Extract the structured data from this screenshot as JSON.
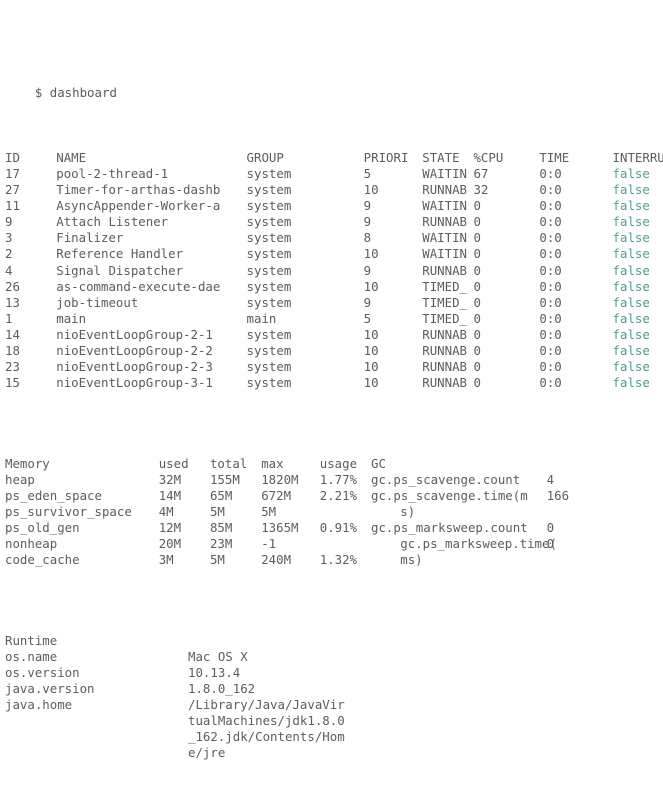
{
  "terminal": {
    "prompt": "$ dashboard",
    "prompt_symbol": "$",
    "command": "dashboard",
    "colors": {
      "background": "#ffffff",
      "text": "#5d5d5d",
      "boolean_false": "#4a9e93"
    }
  },
  "threads": {
    "headers": [
      "ID",
      "NAME",
      "GROUP",
      "PRIORI",
      "STATE",
      "%CPU",
      "TIME",
      "INTERRU"
    ],
    "column_chars": [
      0,
      7,
      33,
      49,
      57,
      64,
      73,
      83
    ],
    "rows": [
      {
        "id": "17",
        "name": "pool-2-thread-1",
        "group": "system",
        "priority": "5",
        "state": "WAITIN",
        "cpu": "67",
        "time": "0:0",
        "interrupted": "false"
      },
      {
        "id": "27",
        "name": "Timer-for-arthas-dashb",
        "group": "system",
        "priority": "10",
        "state": "RUNNAB",
        "cpu": "32",
        "time": "0:0",
        "interrupted": "false"
      },
      {
        "id": "11",
        "name": "AsyncAppender-Worker-a",
        "group": "system",
        "priority": "9",
        "state": "WAITIN",
        "cpu": "0",
        "time": "0:0",
        "interrupted": "false"
      },
      {
        "id": "9",
        "name": "Attach Listener",
        "group": "system",
        "priority": "9",
        "state": "RUNNAB",
        "cpu": "0",
        "time": "0:0",
        "interrupted": "false"
      },
      {
        "id": "3",
        "name": "Finalizer",
        "group": "system",
        "priority": "8",
        "state": "WAITIN",
        "cpu": "0",
        "time": "0:0",
        "interrupted": "false"
      },
      {
        "id": "2",
        "name": "Reference Handler",
        "group": "system",
        "priority": "10",
        "state": "WAITIN",
        "cpu": "0",
        "time": "0:0",
        "interrupted": "false"
      },
      {
        "id": "4",
        "name": "Signal Dispatcher",
        "group": "system",
        "priority": "9",
        "state": "RUNNAB",
        "cpu": "0",
        "time": "0:0",
        "interrupted": "false"
      },
      {
        "id": "26",
        "name": "as-command-execute-dae",
        "group": "system",
        "priority": "10",
        "state": "TIMED_",
        "cpu": "0",
        "time": "0:0",
        "interrupted": "false"
      },
      {
        "id": "13",
        "name": "job-timeout",
        "group": "system",
        "priority": "9",
        "state": "TIMED_",
        "cpu": "0",
        "time": "0:0",
        "interrupted": "false"
      },
      {
        "id": "1",
        "name": "main",
        "group": "main",
        "priority": "5",
        "state": "TIMED_",
        "cpu": "0",
        "time": "0:0",
        "interrupted": "false"
      },
      {
        "id": "14",
        "name": "nioEventLoopGroup-2-1",
        "group": "system",
        "priority": "10",
        "state": "RUNNAB",
        "cpu": "0",
        "time": "0:0",
        "interrupted": "false"
      },
      {
        "id": "18",
        "name": "nioEventLoopGroup-2-2",
        "group": "system",
        "priority": "10",
        "state": "RUNNAB",
        "cpu": "0",
        "time": "0:0",
        "interrupted": "false"
      },
      {
        "id": "23",
        "name": "nioEventLoopGroup-2-3",
        "group": "system",
        "priority": "10",
        "state": "RUNNAB",
        "cpu": "0",
        "time": "0:0",
        "interrupted": "false"
      },
      {
        "id": "15",
        "name": "nioEventLoopGroup-3-1",
        "group": "system",
        "priority": "10",
        "state": "RUNNAB",
        "cpu": "0",
        "time": "0:0",
        "interrupted": "false"
      }
    ]
  },
  "memory": {
    "headers": [
      "Memory",
      "used",
      "total",
      "max",
      "usage",
      "GC"
    ],
    "column_chars": [
      0,
      21,
      28,
      35,
      43,
      50
    ],
    "rows": [
      {
        "name": "heap",
        "used": "32M",
        "total": "155M",
        "max": "1820M",
        "usage": "1.77%",
        "gc_label": "gc.ps_scavenge.count",
        "gc_value": "4"
      },
      {
        "name": "ps_eden_space",
        "used": "14M",
        "total": "65M",
        "max": "672M",
        "usage": "2.21%",
        "gc_label": "gc.ps_scavenge.time(m",
        "gc_value": "166"
      },
      {
        "name": "ps_survivor_space",
        "used": "4M",
        "total": "5M",
        "max": "5M",
        "usage": "",
        "gc_label": "s)",
        "gc_value": "",
        "gc_label_indent": 4
      },
      {
        "name": "ps_old_gen",
        "used": "12M",
        "total": "85M",
        "max": "1365M",
        "usage": "0.91%",
        "gc_label": "gc.ps_marksweep.count",
        "gc_value": "0"
      },
      {
        "name": "nonheap",
        "used": "20M",
        "total": "23M",
        "max": "-1",
        "usage": "",
        "gc_label": "gc.ps_marksweep.time(",
        "gc_value": "0",
        "gc_label_indent": 4
      },
      {
        "name": "code_cache",
        "used": "3M",
        "total": "5M",
        "max": "240M",
        "usage": "1.32%",
        "gc_label": "ms)",
        "gc_value": "",
        "gc_label_indent": 4
      }
    ]
  },
  "runtime": {
    "section_label": "Runtime",
    "value_column_char": 25,
    "rows": [
      {
        "key": "os.name",
        "value": "Mac OS X",
        "continuation": []
      },
      {
        "key": "os.version",
        "value": "10.13.4",
        "continuation": []
      },
      {
        "key": "java.version",
        "value": "1.8.0_162",
        "continuation": []
      },
      {
        "key": "java.home",
        "value": "/Library/Java/JavaVir",
        "continuation": [
          "tualMachines/jdk1.8.0",
          "_162.jdk/Contents/Hom",
          "e/jre"
        ]
      }
    ]
  }
}
